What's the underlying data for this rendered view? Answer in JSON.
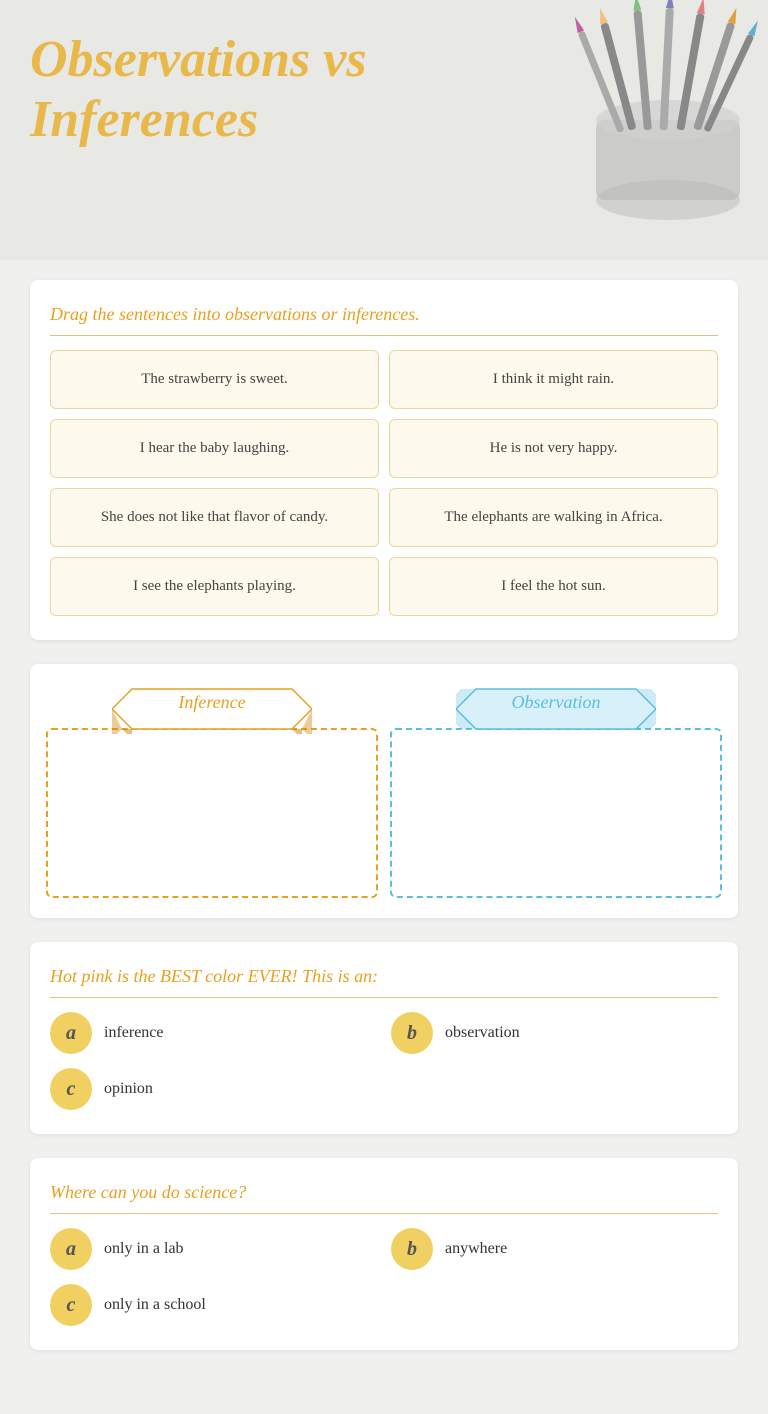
{
  "header": {
    "title_line1": "Observations vs",
    "title_line2": "Inferences"
  },
  "drag_section": {
    "instruction": "Drag the sentences into observations or inferences.",
    "sentences": [
      "The strawberry is sweet.",
      "I think it might rain.",
      "I hear the baby laughing.",
      "He is not very happy.",
      "She does not like that flavor of candy.",
      "The elephants are walking in Africa.",
      "I see the elephants playing.",
      "I feel the hot sun."
    ]
  },
  "drop_zones": {
    "inference_label": "Inference",
    "observation_label": "Observation"
  },
  "question1": {
    "title": "Hot pink is the BEST color EVER! This is an:",
    "options": [
      {
        "letter": "a",
        "text": "inference"
      },
      {
        "letter": "b",
        "text": "observation"
      },
      {
        "letter": "c",
        "text": "opinion"
      }
    ]
  },
  "question2": {
    "title": "Where can you do science?",
    "options": [
      {
        "letter": "a",
        "text": "only in a lab"
      },
      {
        "letter": "b",
        "text": "anywhere"
      },
      {
        "letter": "c",
        "text": "only in a school"
      }
    ]
  }
}
